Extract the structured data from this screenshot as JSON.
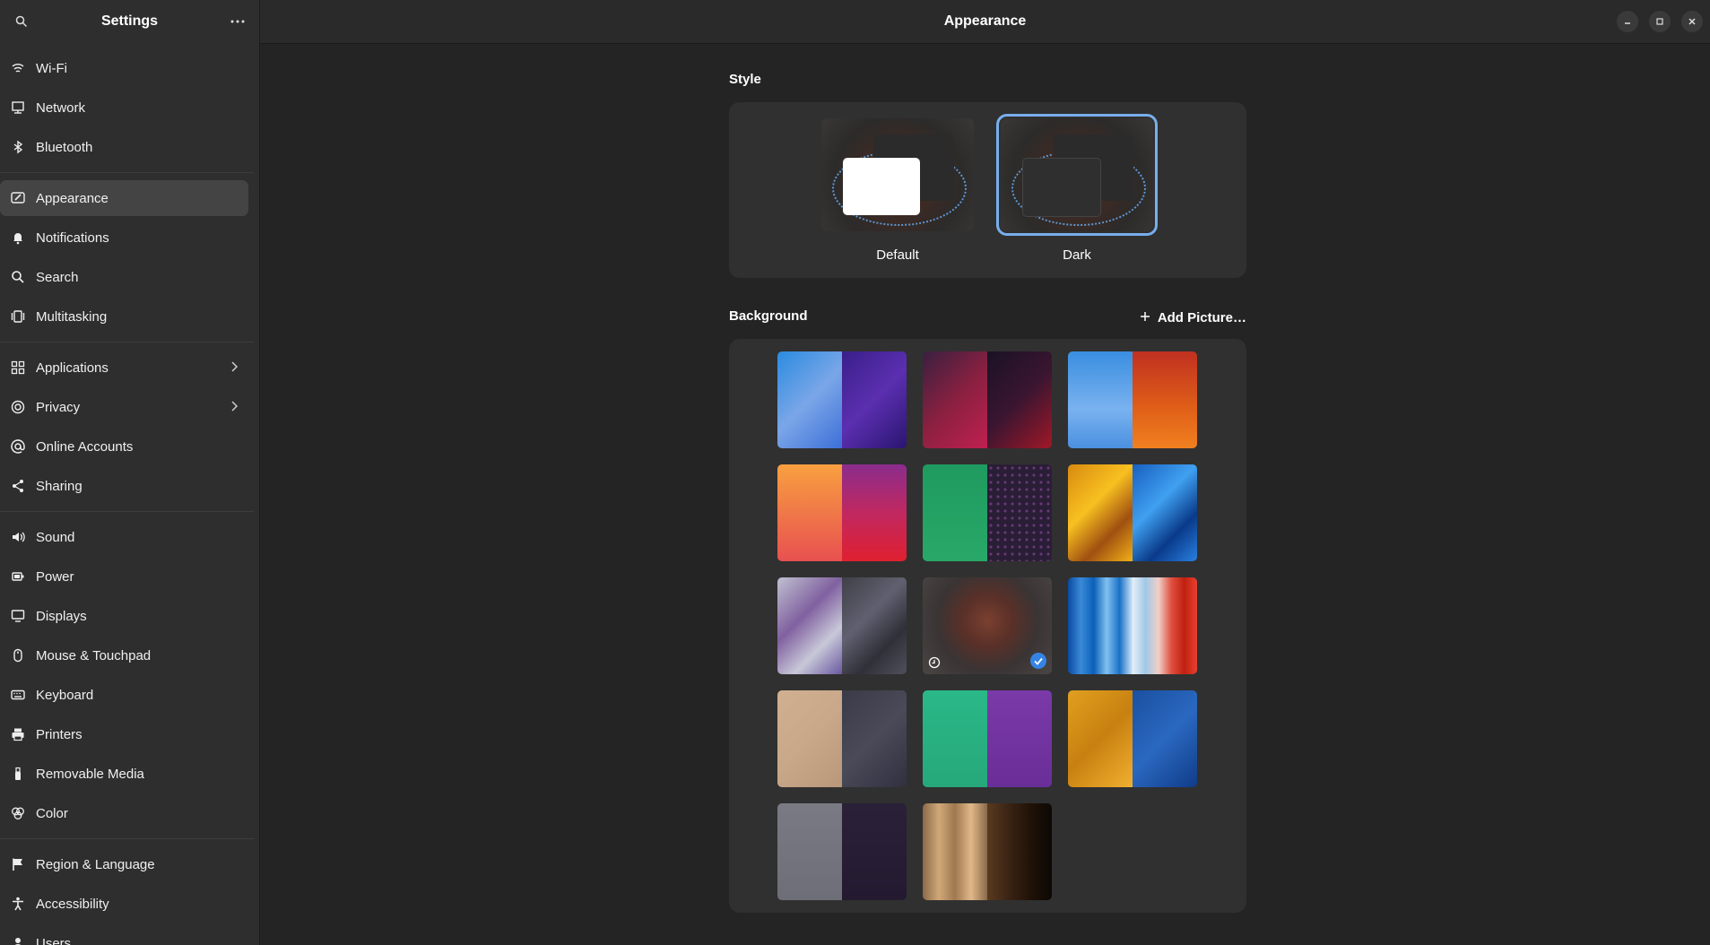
{
  "sidebar": {
    "title": "Settings",
    "groups": [
      [
        {
          "label": "Wi-Fi",
          "icon": "wifi-icon"
        },
        {
          "label": "Network",
          "icon": "network-icon"
        },
        {
          "label": "Bluetooth",
          "icon": "bluetooth-icon"
        }
      ],
      [
        {
          "label": "Appearance",
          "icon": "appearance-icon",
          "active": true
        },
        {
          "label": "Notifications",
          "icon": "bell-icon"
        },
        {
          "label": "Search",
          "icon": "search-icon"
        },
        {
          "label": "Multitasking",
          "icon": "multitasking-icon"
        }
      ],
      [
        {
          "label": "Applications",
          "icon": "grid-icon",
          "chevron": true
        },
        {
          "label": "Privacy",
          "icon": "privacy-icon",
          "chevron": true
        },
        {
          "label": "Online Accounts",
          "icon": "at-icon"
        },
        {
          "label": "Sharing",
          "icon": "share-icon"
        }
      ],
      [
        {
          "label": "Sound",
          "icon": "speaker-icon"
        },
        {
          "label": "Power",
          "icon": "power-icon"
        },
        {
          "label": "Displays",
          "icon": "display-icon"
        },
        {
          "label": "Mouse & Touchpad",
          "icon": "mouse-icon"
        },
        {
          "label": "Keyboard",
          "icon": "keyboard-icon"
        },
        {
          "label": "Printers",
          "icon": "printer-icon"
        },
        {
          "label": "Removable Media",
          "icon": "usb-icon"
        },
        {
          "label": "Color",
          "icon": "color-icon"
        }
      ],
      [
        {
          "label": "Region & Language",
          "icon": "flag-icon"
        },
        {
          "label": "Accessibility",
          "icon": "accessibility-icon"
        },
        {
          "label": "Users",
          "icon": "users-icon"
        }
      ]
    ]
  },
  "header": {
    "title": "Appearance"
  },
  "style": {
    "label": "Style",
    "options": [
      {
        "label": "Default",
        "selected": false
      },
      {
        "label": "Dark",
        "selected": true
      }
    ]
  },
  "background": {
    "label": "Background",
    "add_label": "Add Picture…",
    "tiles": [
      {
        "name": "blobs",
        "l": "linear-gradient(135deg,#2a8be0,#7aa6e8 50%,#3d6fd8)",
        "r": "linear-gradient(135deg,#3a1f8a,#5b2fb0 50%,#2a1570)"
      },
      {
        "name": "pixels",
        "l": "linear-gradient(135deg,#3a2040,#8a2040 50%,#c02050)",
        "r": "linear-gradient(135deg,#1a1225,#3a1530 50%,#a01828)"
      },
      {
        "name": "drool",
        "l": "linear-gradient(180deg,#3a8ee0,#7ab2f0 60%,#4a90e0)",
        "r": "linear-gradient(180deg,#c03020,#e06018 60%,#f08020)"
      },
      {
        "name": "amber",
        "l": "linear-gradient(180deg,#f8a040,#f07848 50%,#e85050)",
        "r": "linear-gradient(180deg,#8a2c8c,#c02860 50%,#e02030)"
      },
      {
        "name": "dots",
        "l": "linear-gradient(180deg,#1f9a60,#28a868)",
        "r": "radial-gradient(circle,#6a3a7a 1px,#2a1e36 2px) 0 0/8px 8px"
      },
      {
        "name": "mosaic",
        "l": "linear-gradient(135deg,#d88a10,#f8c020 40%,#a05010 70%,#f0b018)",
        "r": "linear-gradient(135deg,#1860c0,#40a0f0 40%,#0a3a8a 70%,#2880e0)"
      },
      {
        "name": "pattern",
        "l": "linear-gradient(135deg,#c0c0d0,#8060a0 40%,#c8c8d8 70%,#6a58a0)",
        "r": "linear-gradient(135deg,#404048,#606070 40%,#303038 70%,#50505c)"
      },
      {
        "name": "octopus",
        "full": "radial-gradient(circle at 50% 45%,#7a4030 0%,#5a3028 30%,#3a3434 60%,#4a4644 100%)",
        "selected": true,
        "clock": true
      },
      {
        "name": "stripes",
        "l": "linear-gradient(90deg,#0a4aa0,#3a8ad8,#0a60b8,#80c0f0,#1a70c8,#d0e8f8)",
        "r": "linear-gradient(90deg,#e8f0f8,#a0c8e8,#f0d0c8,#e05040,#c02010,#e84030)"
      },
      {
        "name": "symbolics",
        "l": "linear-gradient(135deg,#d0b090,#c8a888 50%,#b89878)",
        "r": "linear-gradient(135deg,#3a3a48,#4a4a58 50%,#303040)"
      },
      {
        "name": "flat",
        "l": "linear-gradient(180deg,#2ab888,#26a87a)",
        "r": "linear-gradient(180deg,#7a3aa8,#6a2e98)"
      },
      {
        "name": "honeycomb",
        "l": "linear-gradient(135deg,#e0a020,#c88010 50%,#f0b030)",
        "r": "linear-gradient(135deg,#1a50a0,#2a68c0 50%,#103c88)"
      },
      {
        "name": "grey",
        "l": "linear-gradient(180deg,#7a7a84,#6e6e78)",
        "r": "linear-gradient(180deg,#2a2038,#241a30)"
      },
      {
        "name": "wood",
        "l": "linear-gradient(90deg,#8a6a4a,#d0a878,#a07850,#e0b888,#8a6a4a)",
        "r": "linear-gradient(90deg,#5a3a20,#3a2414,#201208,#0e0804)"
      }
    ]
  }
}
